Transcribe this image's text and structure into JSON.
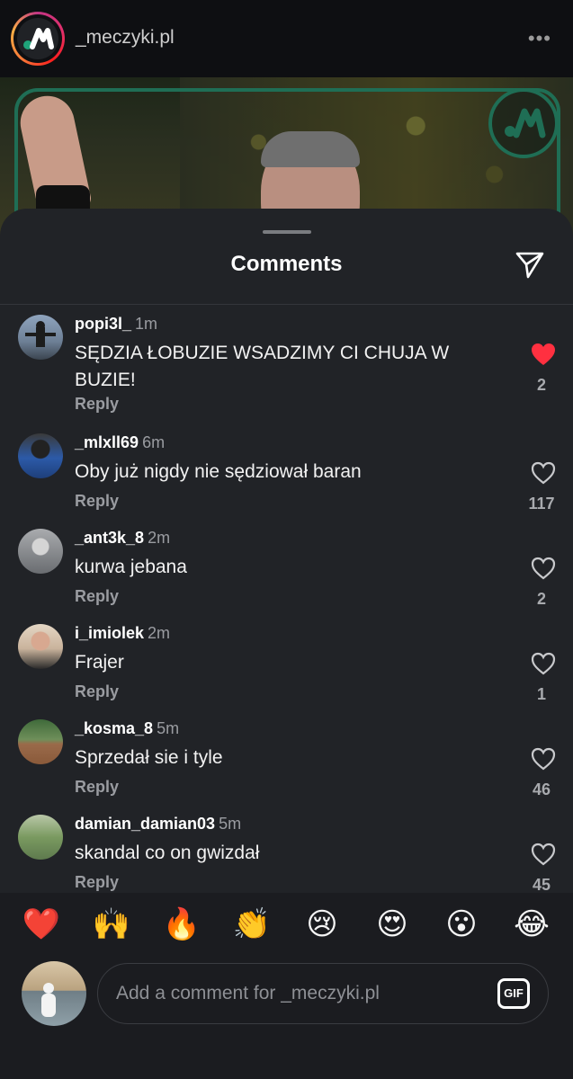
{
  "post": {
    "username": "_meczyki.pl",
    "more_label": "•••"
  },
  "sheet": {
    "title": "Comments"
  },
  "comments": [
    {
      "username": "popi3l_",
      "time": "1m",
      "text": "SĘDZIA ŁOBUZIE WSADZIMY CI CHUJA W BUZIE!",
      "reply": "Reply",
      "likes": "2",
      "liked": true,
      "avatar_color": "#6d7f95"
    },
    {
      "username": "_mlxll69",
      "time": "6m",
      "text": "Oby już nigdy nie sędziował baran",
      "reply": "Reply",
      "likes": "117",
      "liked": false,
      "avatar_color": "#2c5aa8"
    },
    {
      "username": "_ant3k_8",
      "time": "2m",
      "text": "kurwa jebana",
      "reply": "Reply",
      "likes": "2",
      "liked": false,
      "avatar_color": "#8b8e92"
    },
    {
      "username": "i_imiolek",
      "time": "2m",
      "text": "Frajer",
      "reply": "Reply",
      "likes": "1",
      "liked": false,
      "avatar_color": "#c9b39c"
    },
    {
      "username": "_kosma_8",
      "time": "5m",
      "text": "Sprzedał sie i tyle",
      "reply": "Reply",
      "likes": "46",
      "liked": false,
      "avatar_color": "#8a5a3a"
    },
    {
      "username": "damian_damian03",
      "time": "5m",
      "text": "skandal co on gwizdał",
      "reply": "Reply",
      "likes": "45",
      "liked": false,
      "avatar_color": "#5e7a4e"
    }
  ],
  "reactions": [
    "❤️",
    "🙌",
    "🔥",
    "👏",
    "😢",
    "😍",
    "😮",
    "😂"
  ],
  "composer": {
    "placeholder": "Add a comment for _meczyki.pl",
    "gif_label": "GIF"
  },
  "colors": {
    "sheet_bg": "#212327",
    "like_red": "#ff3040",
    "accent_green": "#1f6e55"
  }
}
